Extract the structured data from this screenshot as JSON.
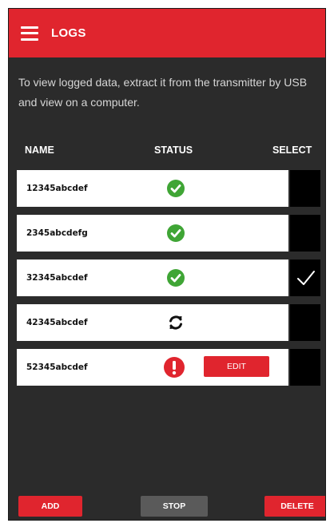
{
  "header": {
    "title": "LOGS",
    "menu_icon": "hamburger-menu-icon"
  },
  "info_text": "To view logged data, extract it from the transmitter by USB and view on a computer.",
  "columns": {
    "name": "NAME",
    "status": "STATUS",
    "select": "SELECT"
  },
  "rows": [
    {
      "name": "12345abcdef",
      "status": "complete",
      "status_icon": "check-circle-icon",
      "selected": false
    },
    {
      "name": "2345abcdefg",
      "status": "complete",
      "status_icon": "check-circle-icon",
      "selected": false
    },
    {
      "name": "32345abcdef",
      "status": "complete",
      "status_icon": "check-circle-icon",
      "selected": true
    },
    {
      "name": "42345abcdef",
      "status": "in-progress",
      "status_icon": "sync-icon",
      "selected": false
    },
    {
      "name": "52345abcdef",
      "status": "error",
      "status_icon": "error-icon",
      "edit_label": "EDIT",
      "selected": false
    }
  ],
  "footer": {
    "add_label": "ADD",
    "stop_label": "STOP",
    "delete_label": "DELETE"
  },
  "colors": {
    "accent": "#e0252e",
    "background": "#2b2b2b",
    "success": "#3fa535",
    "stop_button": "#5a5a5a"
  }
}
